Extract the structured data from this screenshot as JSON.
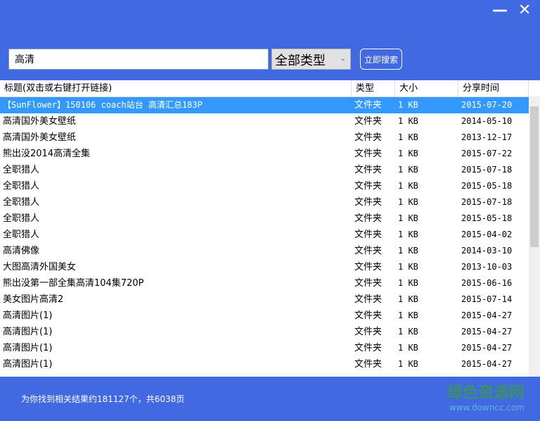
{
  "window": {
    "minimize": "—",
    "close": "✕"
  },
  "search": {
    "value": "高清",
    "type_select": "全部类型",
    "button": "立即搜索"
  },
  "table": {
    "columns": [
      "标题(双击或右键打开链接)",
      "类型",
      "大小",
      "分享时间"
    ],
    "rows": [
      [
        "【SunFlower】150106 coach站台 高清汇总183P",
        "文件夹",
        "1 KB",
        "2015-07-20"
      ],
      [
        "高清国外美女壁纸",
        "文件夹",
        "1 KB",
        "2014-05-10"
      ],
      [
        "高清国外美女壁纸",
        "文件夹",
        "1 KB",
        "2013-12-17"
      ],
      [
        "熊出没2014高清全集",
        "文件夹",
        "1 KB",
        "2015-07-22"
      ],
      [
        "全职猎人",
        "文件夹",
        "1 KB",
        "2015-07-18"
      ],
      [
        "全职猎人",
        "文件夹",
        "1 KB",
        "2015-05-18"
      ],
      [
        "全职猎人",
        "文件夹",
        "1 KB",
        "2015-07-18"
      ],
      [
        "全职猎人",
        "文件夹",
        "1 KB",
        "2015-05-18"
      ],
      [
        "全职猎人",
        "文件夹",
        "1 KB",
        "2015-04-02"
      ],
      [
        "高清佛像",
        "文件夹",
        "1 KB",
        "2014-03-10"
      ],
      [
        "大图高清外国美女",
        "文件夹",
        "1 KB",
        "2013-10-03"
      ],
      [
        "熊出没第一部全集高清104集720P",
        "文件夹",
        "1 KB",
        "2015-06-16"
      ],
      [
        "美女图片高清2",
        "文件夹",
        "1 KB",
        "2015-07-14"
      ],
      [
        "高清图片(1)",
        "文件夹",
        "1 KB",
        "2015-04-27"
      ],
      [
        "高清图片(1)",
        "文件夹",
        "1 KB",
        "2015-04-27"
      ],
      [
        "高清图片(1)",
        "文件夹",
        "1 KB",
        "2015-04-27"
      ],
      [
        "高清图片(1)",
        "文件夹",
        "1 KB",
        "2015-04-27"
      ]
    ]
  },
  "status": "为你找到相关结果约181127个，共6038页",
  "watermark": {
    "name": "绿色资源网",
    "url": "www.downcc.com"
  }
}
